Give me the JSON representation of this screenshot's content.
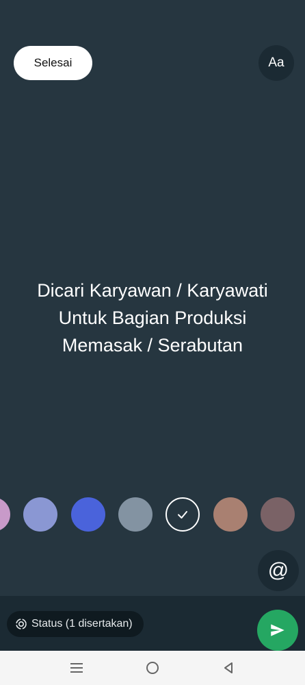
{
  "header": {
    "done_label": "Selesai",
    "font_button_label": "Aa"
  },
  "status_text": {
    "lines": [
      "Dicari Karyawan / Karyawati",
      "Untuk Bagian Produksi",
      "Memasak / Serabutan"
    ]
  },
  "palette": {
    "colors": [
      "#c89ac9",
      "#8a97d3",
      "#4a63db",
      "#8393a2",
      "#263640",
      "#a98071",
      "#7a6266"
    ],
    "selected_index": 4
  },
  "mention_button": {
    "icon": "at-sign-icon",
    "glyph": "@"
  },
  "bottom_bar": {
    "status_chip_label": "Status (1 disertakan)",
    "send_icon": "send-icon"
  },
  "nav": {
    "recents_icon": "menu-icon",
    "home_icon": "circle-home-icon",
    "back_icon": "triangle-back-icon"
  },
  "colors": {
    "background": "#263640",
    "bar": "#1b2a33",
    "send_green": "#25a762",
    "nav_background": "#f5f5f5"
  }
}
